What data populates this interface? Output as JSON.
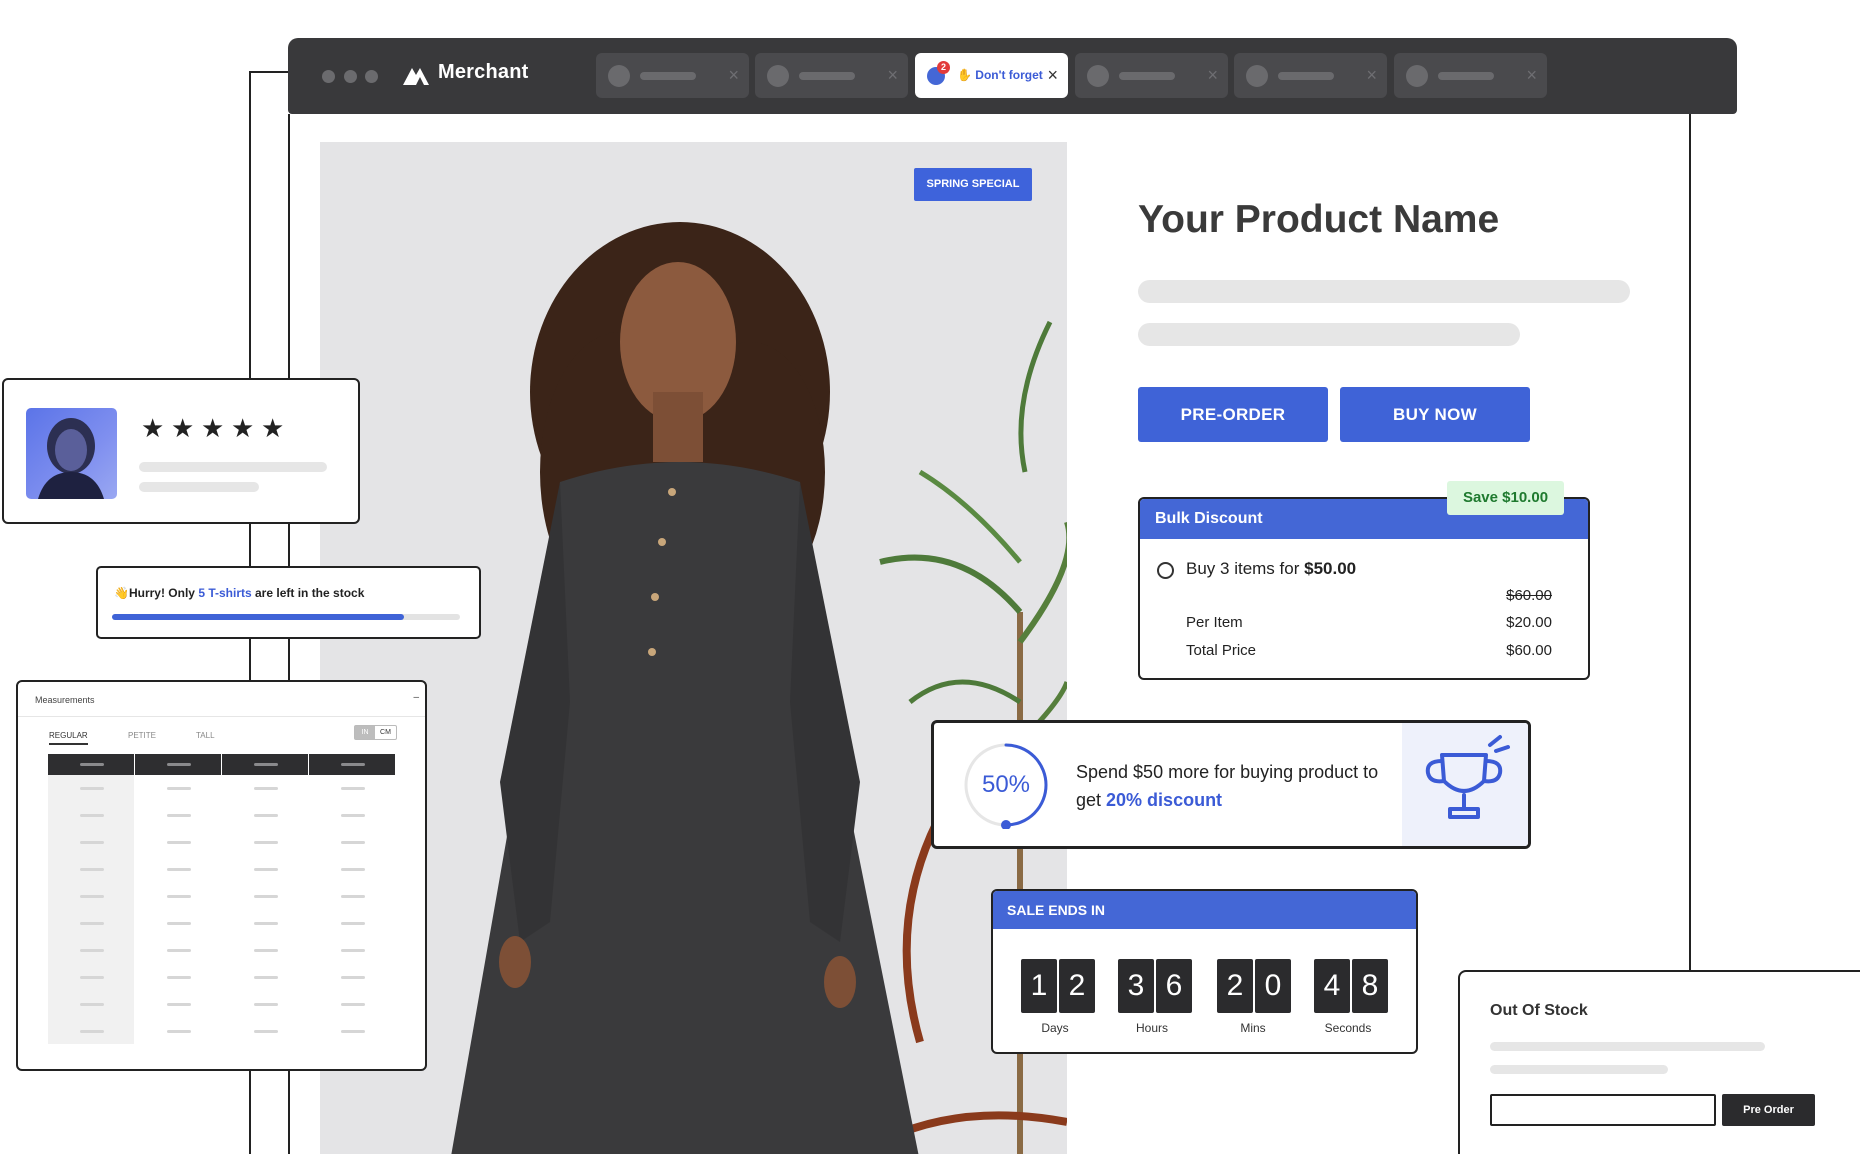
{
  "browser": {
    "brand": "Merchant",
    "active_tab": {
      "badge": "2",
      "title": "✋ Don't forget"
    }
  },
  "product": {
    "badge": "SPRING SPECIAL",
    "name": "Your Product Name",
    "preorder_label": "PRE-ORDER",
    "buynow_label": "BUY NOW"
  },
  "bulk_discount": {
    "title": "Bulk Discount",
    "save_badge": "Save $10.00",
    "offer_prefix": "Buy 3 items for ",
    "offer_price": "$50.00",
    "original_price": "$60.00",
    "rows": [
      {
        "label": "Per Item",
        "value": "$20.00"
      },
      {
        "label": "Total Price",
        "value": "$60.00"
      }
    ]
  },
  "spend_more": {
    "percent": "50%",
    "progress": 0.5,
    "text_prefix": "Spend $50 more for buying product to get ",
    "highlight": "20% discount",
    "accent_color": "#3b5bd6"
  },
  "countdown": {
    "title": "SALE ENDS IN",
    "units": [
      {
        "digits": [
          "1",
          "2"
        ],
        "label": "Days"
      },
      {
        "digits": [
          "3",
          "6"
        ],
        "label": "Hours"
      },
      {
        "digits": [
          "2",
          "0"
        ],
        "label": "Mins"
      },
      {
        "digits": [
          "4",
          "8"
        ],
        "label": "Seconds"
      }
    ]
  },
  "review": {
    "rating": 5,
    "star_glyph": "★"
  },
  "stock_alert": {
    "emoji": "👋",
    "prefix": "Hurry! Only ",
    "highlight": "5 T-shirts",
    "suffix": " are left in the stock",
    "progress": 0.84
  },
  "measurements": {
    "title": "Measurements",
    "minimize": "–",
    "tabs": [
      "REGULAR",
      "PETITE",
      "TALL"
    ],
    "units": [
      "IN",
      "CM"
    ],
    "active_unit": "IN"
  },
  "out_of_stock": {
    "title": "Out Of Stock",
    "button_label": "Pre Order"
  }
}
